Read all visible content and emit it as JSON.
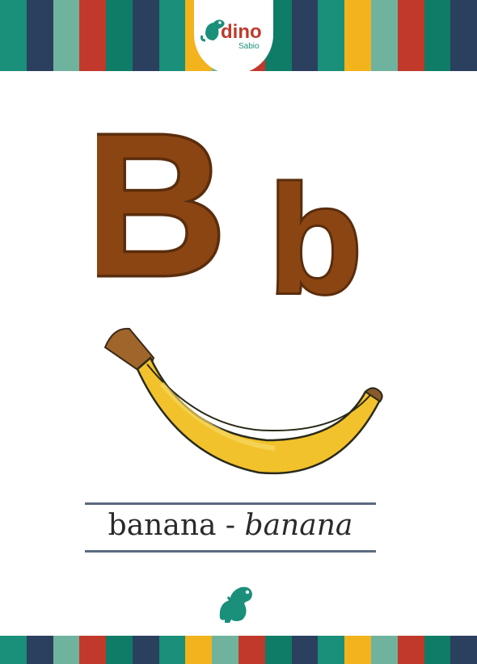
{
  "palette": {
    "stripes": [
      "#1a8f7a",
      "#2b3f5f",
      "#6fb39f",
      "#c0392b",
      "#0e7c66",
      "#2b3f5f",
      "#1a8f7a",
      "#f2b31c",
      "#6fb39f",
      "#c0392b",
      "#0e7c66",
      "#2b3f5f",
      "#1a8f7a",
      "#f2b31c",
      "#6fb39f",
      "#c0392b",
      "#0e7c66",
      "#2b3f5f"
    ],
    "letter_brown": "#8b4513",
    "letter_outline": "#5a2d0c",
    "banana_yellow": "#f2c22c",
    "dino_green": "#1a8f7a"
  },
  "logo": {
    "name": "dino",
    "sub": "Sabio",
    "icon": "dinosaur-icon"
  },
  "card": {
    "letter_upper": "B",
    "letter_lower": "b",
    "image": "banana",
    "word": "banana",
    "separator": " - ",
    "translation": "banana"
  },
  "footer": {
    "icon": "dinosaur-icon"
  }
}
